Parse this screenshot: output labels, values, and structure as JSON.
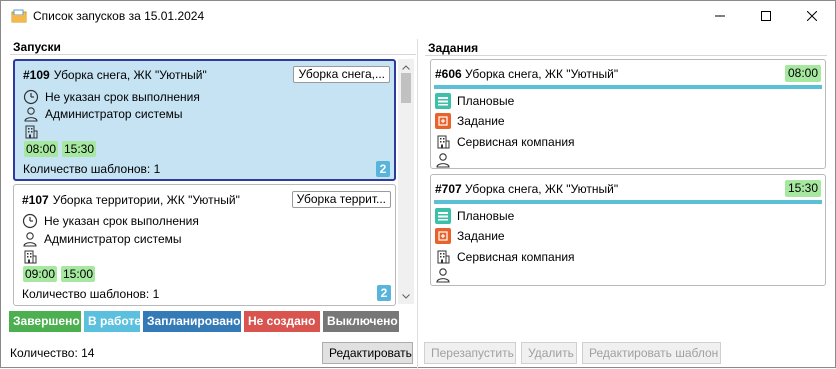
{
  "window": {
    "title": "Список запусков за 15.01.2024"
  },
  "launches": {
    "section_title": "Запуски",
    "cards": [
      {
        "number": "#109",
        "name": "Уборка снега, ЖК \"Уютный\"",
        "template_button": "Уборка снега,...",
        "deadline": "Не указан срок выполнения",
        "user": "Администратор системы",
        "times": [
          "08:00",
          "15:30"
        ],
        "templates_count_label": "Количество шаблонов: 1",
        "badge": "2",
        "selected": true
      },
      {
        "number": "#107",
        "name": "Уборка территории, ЖК \"Уютный\"",
        "template_button": "Уборка террит...",
        "deadline": "Не указан срок выполнения",
        "user": "Администратор системы",
        "times": [
          "09:00",
          "15:00"
        ],
        "templates_count_label": "Количество шаблонов: 1",
        "badge": "2",
        "selected": false
      }
    ],
    "status_buttons": [
      {
        "label": "Завершено",
        "color": "#4caf50"
      },
      {
        "label": "В работе",
        "color": "#5bc0de"
      },
      {
        "label": "Запланировано",
        "color": "#337ab7"
      },
      {
        "label": "Не создано",
        "color": "#d9534f"
      },
      {
        "label": "Выключено",
        "color": "#777777"
      }
    ],
    "count_label": "Количество: 14",
    "edit_button": "Редактировать"
  },
  "tasks": {
    "section_title": "Задания",
    "cards": [
      {
        "number": "#606",
        "name": "Уборка снега, ЖК \"Уютный\"",
        "time": "08:00",
        "type": "Плановые",
        "kind": "Задание",
        "company": "Сервисная компания"
      },
      {
        "number": "#707",
        "name": "Уборка снега, ЖК \"Уютный\"",
        "time": "15:30",
        "type": "Плановые",
        "kind": "Задание",
        "company": "Сервисная компания"
      }
    ],
    "buttons": {
      "restart": "Перезапустить",
      "delete": "Удалить",
      "edit_template": "Редактировать шаблон"
    }
  },
  "colors": {
    "selected_card_bg": "#c5e3f3",
    "selected_card_border": "#2f3a9e",
    "time_chip": "#a6e8a0",
    "badge": "#59b4dc",
    "task_bar": "#5bc0d6",
    "plan_icon": "#3cc0a8",
    "task_icon": "#e8622a"
  },
  "icons": {
    "app": "folder-icon",
    "minimize": "minimize-icon",
    "maximize": "maximize-icon",
    "close": "close-icon",
    "clock": "clock-icon",
    "user": "user-icon",
    "building": "building-icon",
    "plan": "planned-icon",
    "task": "task-icon"
  }
}
